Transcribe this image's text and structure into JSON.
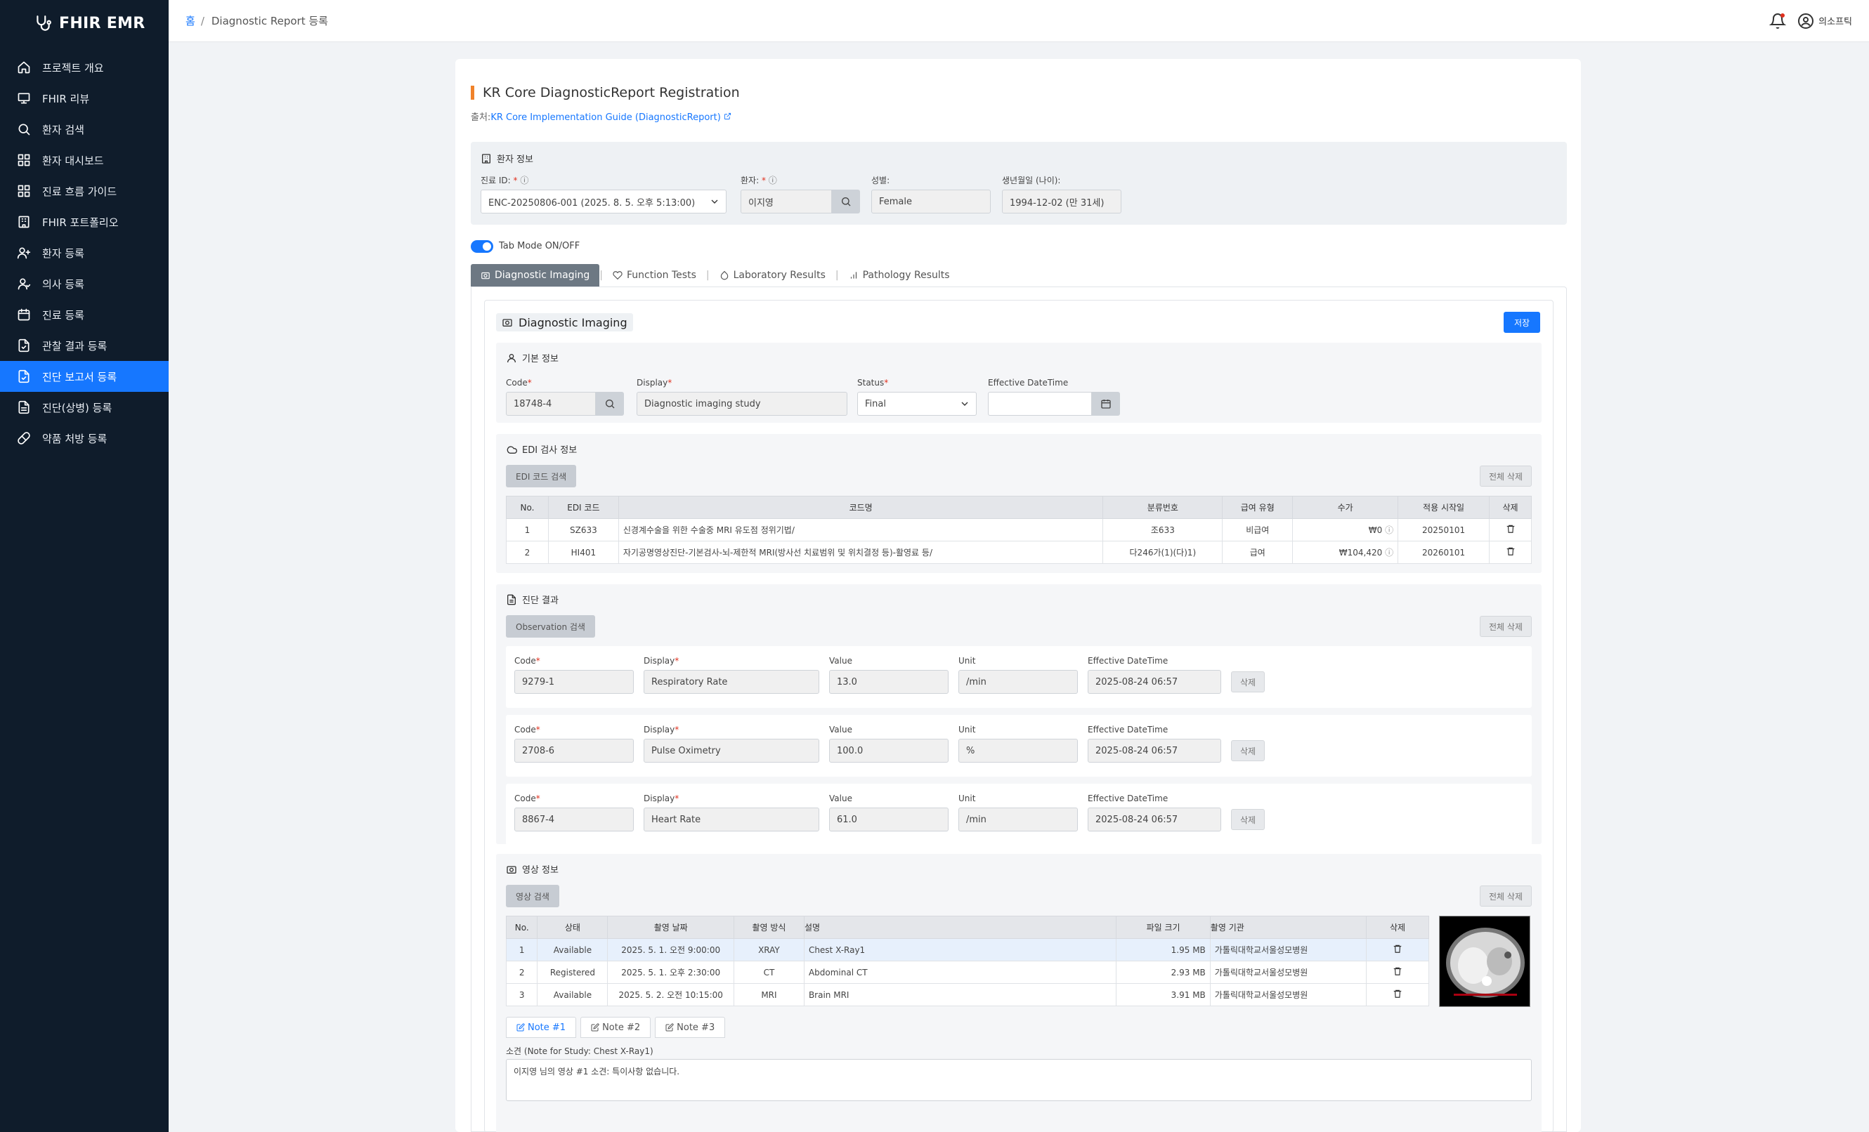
{
  "app": {
    "brand": "FHIR EMR"
  },
  "sidebar": {
    "items": [
      {
        "label": "프로젝트 개요",
        "icon": "home-icon"
      },
      {
        "label": "FHIR 리뷰",
        "icon": "monitor-icon"
      },
      {
        "label": "환자 검색",
        "icon": "search-icon"
      },
      {
        "label": "환자 대시보드",
        "icon": "grid-icon"
      },
      {
        "label": "진료 흐름 가이드",
        "icon": "grid-icon"
      },
      {
        "label": "FHIR 포트폴리오",
        "icon": "building-icon"
      },
      {
        "label": "환자 등록",
        "icon": "user-plus-icon"
      },
      {
        "label": "의사 등록",
        "icon": "user-icon"
      },
      {
        "label": "진료 등록",
        "icon": "calendar-icon"
      },
      {
        "label": "관찰 결과 등록",
        "icon": "file-icon"
      },
      {
        "label": "진단 보고서 등록",
        "icon": "file-icon"
      },
      {
        "label": "진단(상병) 등록",
        "icon": "document-icon"
      },
      {
        "label": "약품 처방 등록",
        "icon": "pill-icon"
      }
    ],
    "active_index": 10
  },
  "breadcrumb": {
    "home": "홈",
    "sep": "/",
    "current": "Diagnostic Report 등록"
  },
  "topbar": {
    "user": "의소프틱"
  },
  "form": {
    "title": "KR Core DiagnosticReport Registration",
    "source_prefix": "출처:",
    "source_link": "KR Core Implementation Guide (DiagnosticReport)",
    "patient": {
      "section_title": "환자 정보",
      "encounter_label": "진료 ID:",
      "encounter_value": "ENC-20250806-001 (2025. 8. 5. 오후 5:13:00)",
      "patient_label": "환자:",
      "patient_value": "이지영",
      "gender_label": "성별:",
      "gender_value": "Female",
      "dob_label": "생년월일 (나이):",
      "dob_value": "1994-12-02 (만 31세)"
    },
    "tab_mode_label": "Tab Mode ON/OFF",
    "tabs": [
      "Diagnostic Imaging",
      "Function Tests",
      "Laboratory Results",
      "Pathology Results"
    ],
    "panel_title": "Diagnostic Imaging",
    "save_label": "저장",
    "basic": {
      "title": "기본 정보",
      "code_label": "Code",
      "code_value": "18748-4",
      "display_label": "Display",
      "display_value": "Diagnostic imaging study",
      "status_label": "Status",
      "status_value": "Final",
      "effective_label": "Effective DateTime",
      "effective_value": ""
    },
    "edi": {
      "title": "EDI 검사 정보",
      "search_btn": "EDI 코드 검색",
      "delete_all": "전체 삭제",
      "headers": [
        "No.",
        "EDI 코드",
        "코드명",
        "분류번호",
        "급여 유형",
        "수가",
        "적용 시작일",
        "삭제"
      ],
      "rows": [
        {
          "no": "1",
          "code": "SZ633",
          "name": "신경계수술을 위한 수술중 MRI 유도점 정위기법/",
          "cls": "조633",
          "type": "비급여",
          "price": "₩0",
          "start": "20250101"
        },
        {
          "no": "2",
          "code": "HI401",
          "name": "자기공명영상진단-기본검사-뇌-제한적 MRI(방사선 치료범위 및 위치결정 등)-활영료 등/",
          "cls": "다246가(1)(다)1)",
          "type": "급여",
          "price": "₩104,420",
          "start": "20260101"
        }
      ]
    },
    "results": {
      "title": "진단 결과",
      "search_btn": "Observation 검색",
      "delete_all": "전체 삭제",
      "labels": {
        "code": "Code",
        "display": "Display",
        "value": "Value",
        "unit": "Unit",
        "effective": "Effective DateTime",
        "delete": "삭제"
      },
      "rows": [
        {
          "code": "9279-1",
          "display": "Respiratory Rate",
          "value": "13.0",
          "unit": "/min",
          "effective": "2025-08-24 06:57"
        },
        {
          "code": "2708-6",
          "display": "Pulse Oximetry",
          "value": "100.0",
          "unit": "%",
          "effective": "2025-08-24 06:57"
        },
        {
          "code": "8867-4",
          "display": "Heart Rate",
          "value": "61.0",
          "unit": "/min",
          "effective": "2025-08-24 06:57"
        }
      ]
    },
    "imaging": {
      "title": "영상 정보",
      "search_btn": "영상 검색",
      "delete_all": "전체 삭제",
      "headers": [
        "No.",
        "상태",
        "촬영 날짜",
        "촬영 방식",
        "설명",
        "파일 크기",
        "촬영 기관",
        "삭제"
      ],
      "rows": [
        {
          "no": "1",
          "status": "Available",
          "date": "2025. 5. 1. 오전 9:00:00",
          "modality": "XRAY",
          "desc": "Chest X-Ray1",
          "size": "1.95 MB",
          "org": "가톨릭대학교서울성모병원"
        },
        {
          "no": "2",
          "status": "Registered",
          "date": "2025. 5. 1. 오후 2:30:00",
          "modality": "CT",
          "desc": "Abdominal CT",
          "size": "2.93 MB",
          "org": "가톨릭대학교서울성모병원"
        },
        {
          "no": "3",
          "status": "Available",
          "date": "2025. 5. 2. 오전 10:15:00",
          "modality": "MRI",
          "desc": "Brain MRI",
          "size": "3.91 MB",
          "org": "가톨릭대학교서울성모병원"
        }
      ],
      "note_tabs": [
        "Note #1",
        "Note #2",
        "Note #3"
      ],
      "note_label": "소견 (Note for Study: Chest X-Ray1)",
      "note_text": "이지영 님의 영상 #1 소견: 특이사항 없습니다."
    }
  }
}
